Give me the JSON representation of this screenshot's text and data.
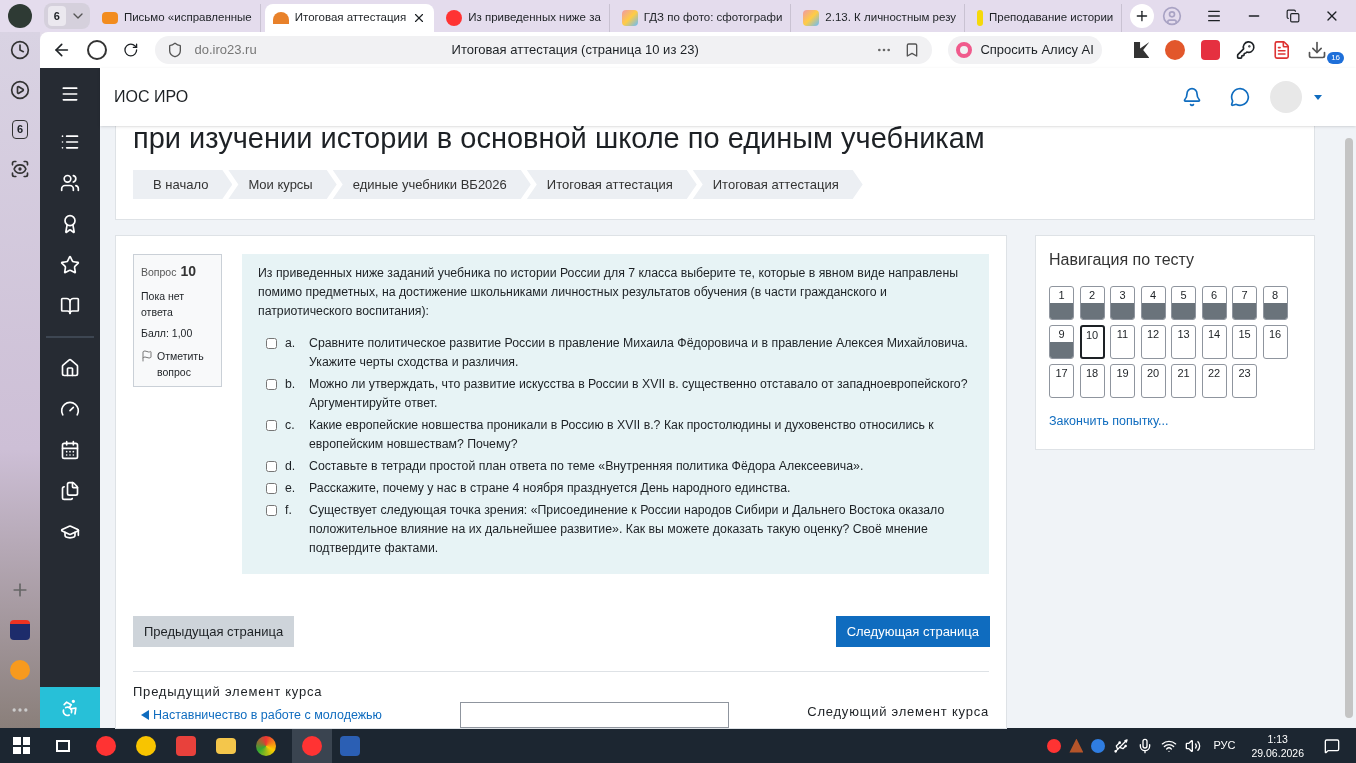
{
  "browser": {
    "tab_count": "6",
    "tabs": [
      {
        "title": "Письмо «исправленные",
        "selected": false
      },
      {
        "title": "Итоговая аттестация",
        "selected": true
      },
      {
        "title": "Из приведенных ниже за",
        "selected": false
      },
      {
        "title": "ГДЗ по фото: сфотографи",
        "selected": false
      },
      {
        "title": "2.13. К личностным резу",
        "selected": false
      },
      {
        "title": "Преподавание истории",
        "selected": false
      }
    ],
    "url": "do.iro23.ru",
    "page_title": "Итоговая аттестация (страница 10 из 23)",
    "alice": "Спросить Алису AI",
    "extension_badge": "16",
    "side_badge": "6"
  },
  "site": {
    "name": "ИОС ИРО"
  },
  "heading": "при изучении истории в основной школе по единым учебникам",
  "breadcrumbs": [
    "В начало",
    "Мои курсы",
    "единые учебники ВБ2026",
    "Итоговая аттестация",
    "Итоговая аттестация"
  ],
  "question": {
    "label": "Вопрос",
    "number": "10",
    "status": "Пока нет ответа",
    "grade": "Балл: 1,00",
    "flag": "Отметить вопрос",
    "prompt": "Из приведенных ниже заданий учебника по истории России для 7 класса выберите те, которые в явном виде направлены помимо предметных, на достижение школьниками личностных результатов обучения (в части гражданского и патриотического воспитания):",
    "options": [
      {
        "letter": "a.",
        "text": "Сравните политическое развитие России в правление Михаила Фёдоровича и в правление Алексея Михайловича. Укажите черты сходства и различия.",
        "checked": false
      },
      {
        "letter": "b.",
        "text": "Можно ли утверждать, что развитие искусства в России в XVII в. существенно отставало от западноевропейского? Аргументируйте ответ.",
        "checked": false
      },
      {
        "letter": "c.",
        "text": "Какие европейские новшества проникали в Россию в XVII в.? Как простолюдины и духовенство относились к европейским новшествам? Почему?",
        "checked": false
      },
      {
        "letter": "d.",
        "text": "Составьте в тетради простой план ответа по теме «Внутренняя политика Фёдора Алексеевича».",
        "checked": false
      },
      {
        "letter": "e.",
        "text": "Расскажите, почему у нас в стране 4 ноября празднуется День народного единства.",
        "checked": false
      },
      {
        "letter": "f.",
        "text": "Существует следующая точка зрения: «Присоединение к России народов Сибири и Дальнего Востока оказало положительное влияние на их дальнейшее развитие». Как вы можете доказать такую оценку? Своё мнение подтвердите фактами.",
        "checked": false
      }
    ]
  },
  "buttons": {
    "previous": "Предыдущая страница",
    "next": "Следующая страница"
  },
  "navigation": {
    "title": "Навигация по тесту",
    "finish": "Закончить попытку...",
    "questions": [
      {
        "label": "1",
        "answered": true,
        "selected": false
      },
      {
        "label": "2",
        "answered": true,
        "selected": false
      },
      {
        "label": "3",
        "answered": true,
        "selected": false
      },
      {
        "label": "4",
        "answered": true,
        "selected": false
      },
      {
        "label": "5",
        "answered": true,
        "selected": false
      },
      {
        "label": "6",
        "answered": true,
        "selected": false
      },
      {
        "label": "7",
        "answered": true,
        "selected": false
      },
      {
        "label": "8",
        "answered": true,
        "selected": false
      },
      {
        "label": "9",
        "answered": true,
        "selected": false
      },
      {
        "label": "10",
        "answered": false,
        "selected": true
      },
      {
        "label": "11",
        "answered": false,
        "selected": false
      },
      {
        "label": "12",
        "answered": false,
        "selected": false
      },
      {
        "label": "13",
        "answered": false,
        "selected": false
      },
      {
        "label": "14",
        "answered": false,
        "selected": false
      },
      {
        "label": "15",
        "answered": false,
        "selected": false
      },
      {
        "label": "16",
        "answered": false,
        "selected": false
      },
      {
        "label": "17",
        "answered": false,
        "selected": false
      },
      {
        "label": "18",
        "answered": false,
        "selected": false
      },
      {
        "label": "19",
        "answered": false,
        "selected": false
      },
      {
        "label": "20",
        "answered": false,
        "selected": false
      },
      {
        "label": "21",
        "answered": false,
        "selected": false
      },
      {
        "label": "22",
        "answered": false,
        "selected": false
      },
      {
        "label": "23",
        "answered": false,
        "selected": false
      }
    ]
  },
  "footer": {
    "previous_label": "Предыдущий элемент курса",
    "previous_link": "Наставничество в работе с молодежью",
    "next_label": "Следующий элемент курса"
  },
  "taskbar": {
    "language": "РУС",
    "time": "1:13",
    "date": "29.06.2026"
  }
}
